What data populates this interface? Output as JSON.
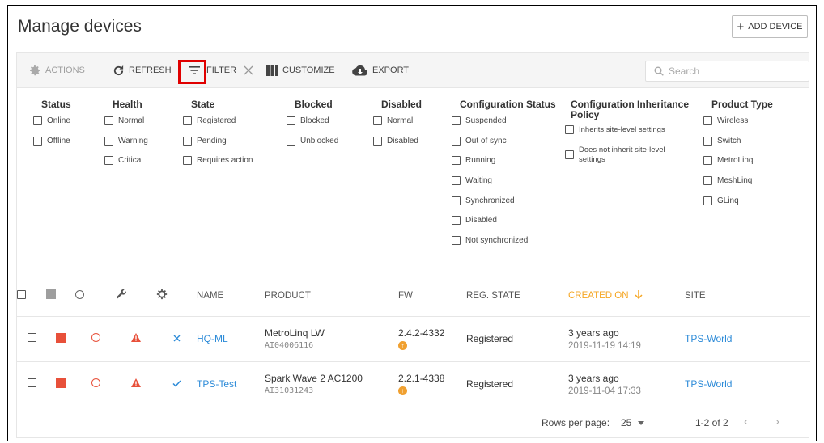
{
  "page": {
    "title": "Manage devices",
    "add_device_label": "ADD DEVICE"
  },
  "toolbar": {
    "actions": "ACTIONS",
    "refresh": "REFRESH",
    "filter": "FILTER",
    "customize": "CUSTOMIZE",
    "export": "EXPORT",
    "search_placeholder": "Search"
  },
  "filters": {
    "status": {
      "title": "Status",
      "options": [
        "Online",
        "Offline"
      ]
    },
    "health": {
      "title": "Health",
      "options": [
        "Normal",
        "Warning",
        "Critical"
      ]
    },
    "state": {
      "title": "State",
      "options": [
        "Registered",
        "Pending",
        "Requires action"
      ]
    },
    "blocked": {
      "title": "Blocked",
      "options": [
        "Blocked",
        "Unblocked"
      ]
    },
    "disabled": {
      "title": "Disabled",
      "options": [
        "Normal",
        "Disabled"
      ]
    },
    "config_status": {
      "title": "Configuration Status",
      "options": [
        "Suspended",
        "Out of sync",
        "Running",
        "Waiting",
        "Synchronized",
        "Disabled",
        "Not synchronized"
      ]
    },
    "config_inheritance": {
      "title_line1": "Configuration Inheritance",
      "title_line2": "Policy",
      "options": [
        "Inherits site-level settings",
        "Does not inherit site-level",
        "settings"
      ]
    },
    "product_type": {
      "title": "Product Type",
      "options": [
        "Wireless",
        "Switch",
        "MetroLinq",
        "MeshLinq",
        "GLinq"
      ]
    }
  },
  "table": {
    "headers": {
      "name": "NAME",
      "product": "PRODUCT",
      "fw": "FW",
      "reg_state": "REG. STATE",
      "created_on": "CREATED ON",
      "site": "SITE"
    },
    "rows": [
      {
        "name": "HQ-ML",
        "product": "MetroLinq LW",
        "serial": "AI04006116",
        "fw": "2.4.2-4332",
        "reg_state": "Registered",
        "created_rel": "3 years ago",
        "created_abs": "2019-11-19 14:19",
        "site": "TPS-World",
        "state_icon": "x-icon"
      },
      {
        "name": "TPS-Test",
        "product": "Spark Wave 2 AC1200",
        "serial": "AI31031243",
        "fw": "2.2.1-4338",
        "reg_state": "Registered",
        "created_rel": "3 years ago",
        "created_abs": "2019-11-04 17:33",
        "site": "TPS-World",
        "state_icon": "check-icon"
      }
    ]
  },
  "pagination": {
    "rows_per_page_label": "Rows per page:",
    "rows_per_page": "25",
    "range": "1-2 of 2"
  },
  "colors": {
    "accent_orange": "#f5a623",
    "link_blue": "#2d8bd8",
    "alert_red": "#e8503a",
    "highlight_red": "#e00000"
  }
}
